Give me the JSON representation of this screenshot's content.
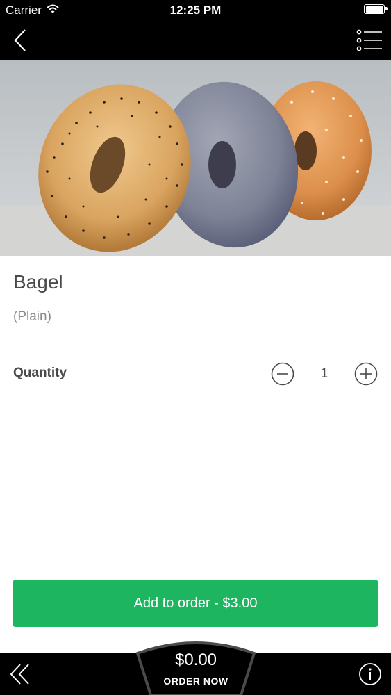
{
  "status_bar": {
    "carrier": "Carrier",
    "time": "12:25 PM"
  },
  "nav": {
    "back_icon": "chevron-left-icon",
    "menu_icon": "list-menu-icon"
  },
  "product": {
    "image_icon": "bagels-photo",
    "title": "Bagel",
    "variant": "(Plain)"
  },
  "quantity": {
    "label": "Quantity",
    "value": "1",
    "decrement_icon": "minus-circle-icon",
    "increment_icon": "plus-circle-icon"
  },
  "add_button": {
    "label": "Add to order - $3.00",
    "color": "#1db560"
  },
  "bottom_bar": {
    "order_total": "$0.00",
    "order_label": "ORDER NOW",
    "back_icon": "double-chevron-left-icon",
    "info_icon": "info-circle-icon"
  }
}
